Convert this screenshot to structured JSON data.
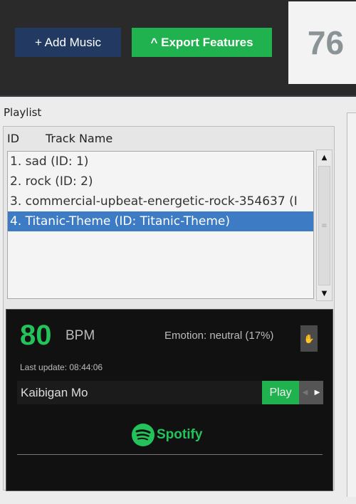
{
  "toolbar": {
    "add_music": "+ Add Music",
    "export_features": "^ Export Features",
    "counter": "76",
    "colors": {
      "add": "#223a62",
      "export": "#20b24f"
    }
  },
  "playlist": {
    "label": "Playlist",
    "columns": [
      "ID",
      "Track Name"
    ],
    "items": [
      {
        "label": "1. sad (ID: 1)",
        "selected": false
      },
      {
        "label": "2. rock (ID: 2)",
        "selected": false
      },
      {
        "label": "3. commercial-upbeat-energetic-rock-354637 (I",
        "selected": false
      },
      {
        "label": "4. Titanic-Theme (ID: Titanic-Theme)",
        "selected": true
      }
    ]
  },
  "player": {
    "bpm": "80",
    "bpm_unit": "BPM",
    "emotion": "Emotion: neutral (17%)",
    "last_update": "Last update: 08:44:06",
    "track": "Kaibigan Mo",
    "play": "Play",
    "brand": "Spotify",
    "accent": "#24c25a"
  }
}
